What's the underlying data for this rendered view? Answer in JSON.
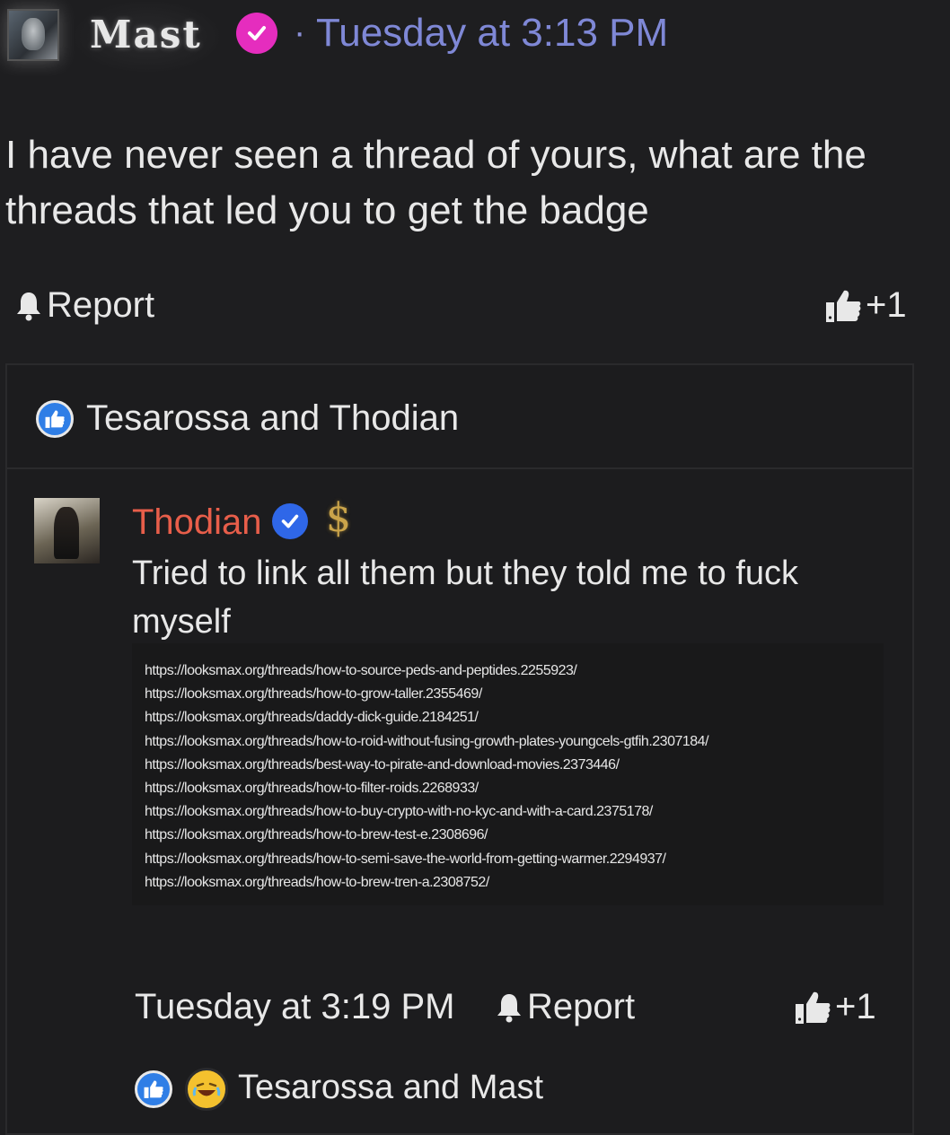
{
  "post": {
    "author": "Mast",
    "separator": "·",
    "time": "Tuesday at 3:13 PM",
    "text": "I have never seen a thread of yours, what are the threads that led you to get the badge",
    "report_label": "Report",
    "like_count": "+1",
    "reactions_text": "Tesarossa and Thodian"
  },
  "reply": {
    "author": "Thodian",
    "dollar_symbol": "$",
    "text": "Tried to link all them but they told me to fuck myself",
    "links": [
      "https://looksmax.org/threads/how-to-source-peds-and-peptides.2255923/",
      "https://looksmax.org/threads/how-to-grow-taller.2355469/",
      "https://looksmax.org/threads/daddy-dick-guide.2184251/",
      "https://looksmax.org/threads/how-to-roid-without-fusing-growth-plates-youngcels-gtfih.2307184/",
      "https://looksmax.org/threads/best-way-to-pirate-and-download-movies.2373446/",
      "https://looksmax.org/threads/how-to-filter-roids.2268933/",
      "https://looksmax.org/threads/how-to-buy-crypto-with-no-kyc-and-with-a-card.2375178/",
      "https://looksmax.org/threads/how-to-brew-test-e.2308696/",
      "https://looksmax.org/threads/how-to-semi-save-the-world-from-getting-warmer.2294937/",
      "https://looksmax.org/threads/how-to-brew-tren-a.2308752/"
    ],
    "time": "Tuesday at 3:19 PM",
    "report_label": "Report",
    "like_count": "+1",
    "reactions_text": "Tesarossa and Mast"
  },
  "colors": {
    "background": "#1e1e20",
    "time_link": "#7f88d6",
    "mast_badge": "#e52dbe",
    "thodian_name": "#e85e4a",
    "verified_badge": "#2f67e8",
    "like_reaction": "#2f7ee6"
  },
  "icons": [
    "bell-icon",
    "thumbs-up-icon",
    "verified-check-icon",
    "dollar-icon",
    "laughing-emoji-icon"
  ]
}
